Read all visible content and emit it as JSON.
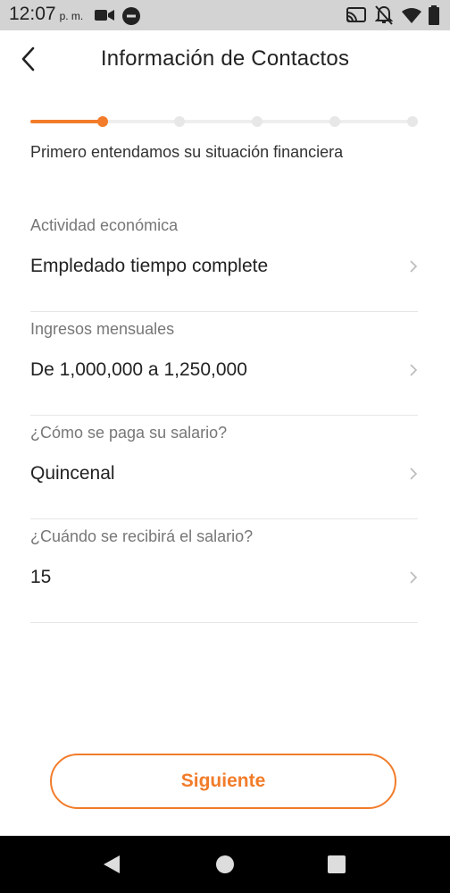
{
  "status_bar": {
    "time": "12:07",
    "ampm": "p. m.",
    "icons": [
      "video-camera-icon",
      "minus-circle-icon",
      "cast-icon",
      "bell-off-icon",
      "wifi-icon",
      "battery-icon"
    ]
  },
  "header": {
    "title": "Información de Contactos",
    "back_icon": "chevron-left-icon"
  },
  "progress": {
    "current_step": 2,
    "total_steps": 6,
    "accent_color": "#f27c2a"
  },
  "subtitle": "Primero entendamos su situación financiera",
  "fields": [
    {
      "label": "Actividad económica",
      "value": "Empledado tiempo complete"
    },
    {
      "label": "Ingresos mensuales",
      "value": "De 1,000,000 a 1,250,000"
    },
    {
      "label": "¿Cómo se paga su salario?",
      "value": "Quincenal"
    },
    {
      "label": "¿Cuándo se recibirá el salario?",
      "value": "15"
    }
  ],
  "next_button": {
    "label": "Siguiente"
  },
  "nav_bar": {
    "icons": [
      "back-triangle-icon",
      "home-circle-icon",
      "recents-square-icon"
    ]
  }
}
